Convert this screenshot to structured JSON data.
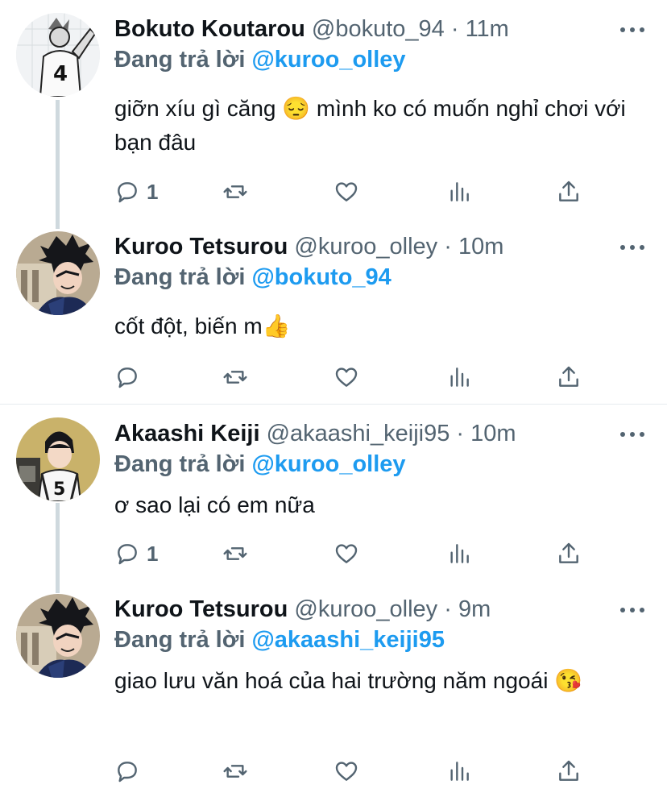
{
  "tweets": [
    {
      "name": "Bokuto Koutarou",
      "handle": "@bokuto_94",
      "sep": "·",
      "time": "11m",
      "reply_prefix": "Đang trả lời",
      "reply_mention": "@kuroo_olley",
      "text": "giỡn xíu gì căng 😔  mình ko có muốn nghỉ chơi với bạn đâu",
      "reply_count": "1",
      "avatar_icon": "bokuto-avatar"
    },
    {
      "name": "Kuroo Tetsurou",
      "handle": "@kuroo_olley",
      "sep": "·",
      "time": "10m",
      "reply_prefix": "Đang trả lời",
      "reply_mention": "@bokuto_94",
      "text": "cốt đột, biến m👍",
      "reply_count": "",
      "avatar_icon": "kuroo-avatar"
    },
    {
      "name": "Akaashi Keiji",
      "handle": "@akaashi_keiji95",
      "sep": "·",
      "time": "10m",
      "reply_prefix": "Đang trả lời",
      "reply_mention": "@kuroo_olley",
      "text": "ơ sao lại có em nữa",
      "reply_count": "1",
      "avatar_icon": "akaashi-avatar"
    },
    {
      "name": "Kuroo Tetsurou",
      "handle": "@kuroo_olley",
      "sep": "·",
      "time": "9m",
      "reply_prefix": "Đang trả lời",
      "reply_mention": "@akaashi_keiji95",
      "text": "giao lưu văn hoá của hai trường năm ngoái 😘",
      "reply_count": "",
      "avatar_icon": "kuroo-avatar"
    }
  ],
  "colors": {
    "text": "#0f1419",
    "secondary": "#536471",
    "accent": "#1d9bf0",
    "thread_line": "#cfd9de"
  }
}
